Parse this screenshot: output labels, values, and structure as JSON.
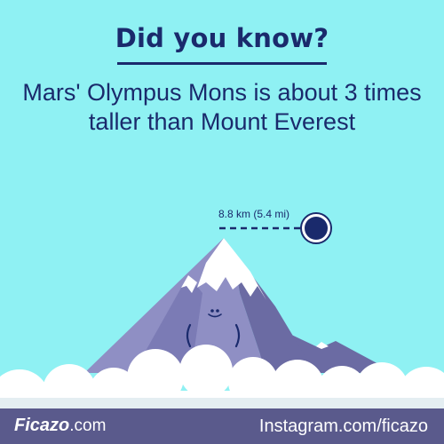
{
  "header": {
    "title": "Did you know?"
  },
  "fact": {
    "line1": "Mars' Olympus Mons is about 3 times",
    "line2": "taller than Mount Everest"
  },
  "illustration": {
    "height_label": "8.8 km (5.4 mi)",
    "colors": {
      "sky": "#8ff1f3",
      "navy": "#1a2a6c",
      "mountain_light": "#8f8fc4",
      "mountain_dark": "#6b6ba3",
      "snow": "#ffffff",
      "cloud_shadow": "#e4eef2"
    }
  },
  "footer": {
    "brand_name": "Ficazo",
    "brand_tld": ".com",
    "social": "Instagram.com/ficazo",
    "background": "#5a5a8c"
  }
}
